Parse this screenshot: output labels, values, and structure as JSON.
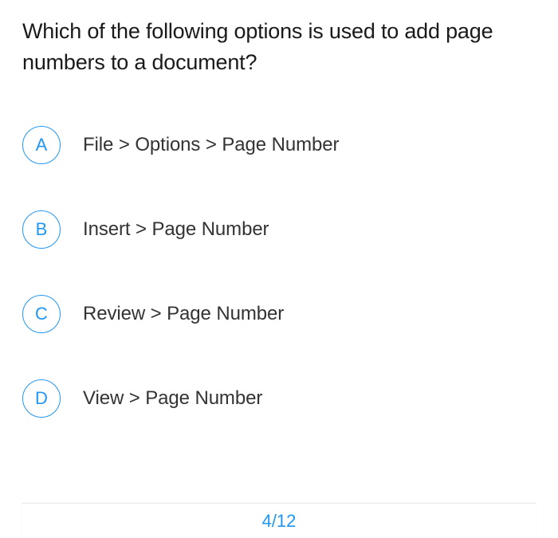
{
  "question": "Which of the following options is used to add page numbers to a document?",
  "options": [
    {
      "letter": "A",
      "text": "File > Options > Page Number"
    },
    {
      "letter": "B",
      "text": "Insert > Page Number"
    },
    {
      "letter": "C",
      "text": "Review > Page Number"
    },
    {
      "letter": "D",
      "text": "View > Page Number"
    }
  ],
  "progress": "4/12"
}
